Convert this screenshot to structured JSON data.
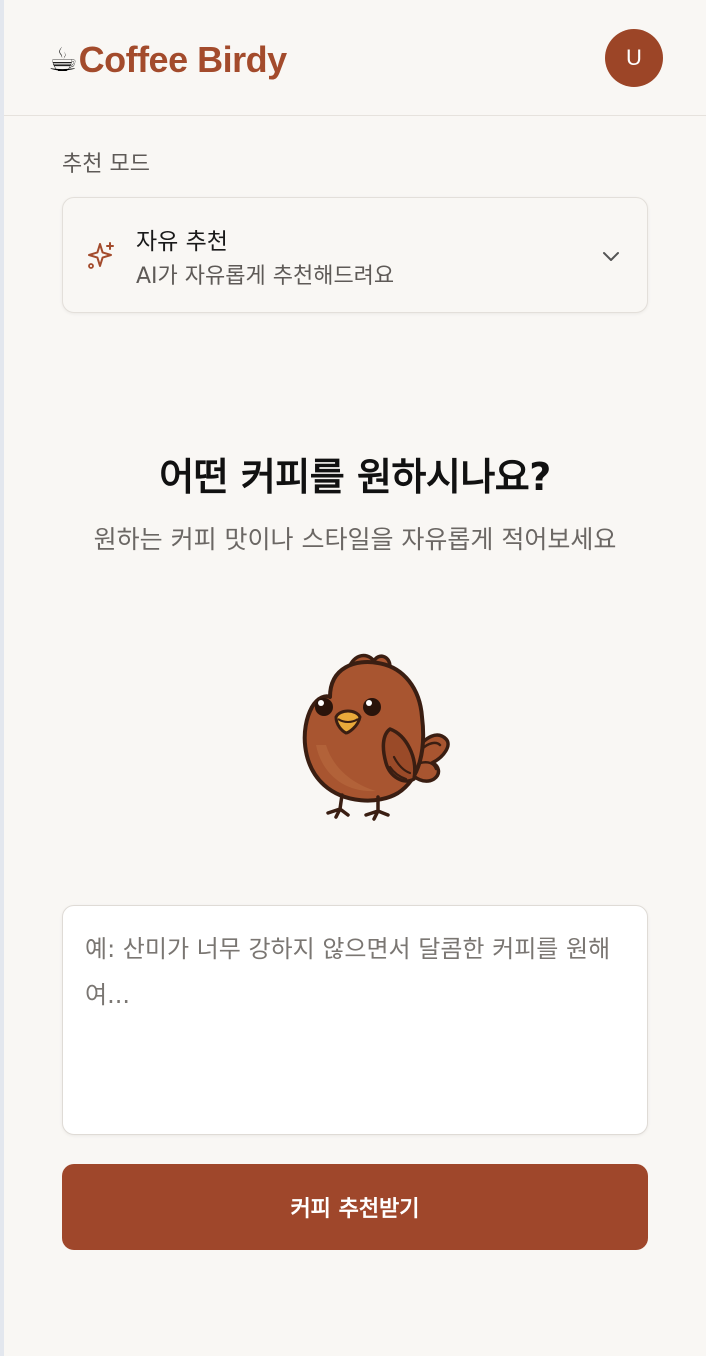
{
  "app": {
    "brand_icon": "☕",
    "brand_name": "Coffee Birdy",
    "avatar_initial": "U"
  },
  "mode": {
    "label": "추천 모드",
    "selected_title": "자유 추천",
    "selected_description": "AI가 자유롭게 추천해드려요",
    "icon": "sparkles-icon"
  },
  "main": {
    "heading": "어떤 커피를 원하시나요?",
    "subheading": "원하는 커피 맛이나 스타일을 자유롭게 적어보세요",
    "mascot": "bird-mascot"
  },
  "prompt": {
    "value": "",
    "placeholder": "예: 산미가 너무 강하지 않으면서 달콤한 커피를 원해여..."
  },
  "actions": {
    "submit_label": "커피 추천받기"
  },
  "colors": {
    "accent": "#9f472b",
    "brand": "#a34b2c",
    "background": "#f9f7f4"
  }
}
